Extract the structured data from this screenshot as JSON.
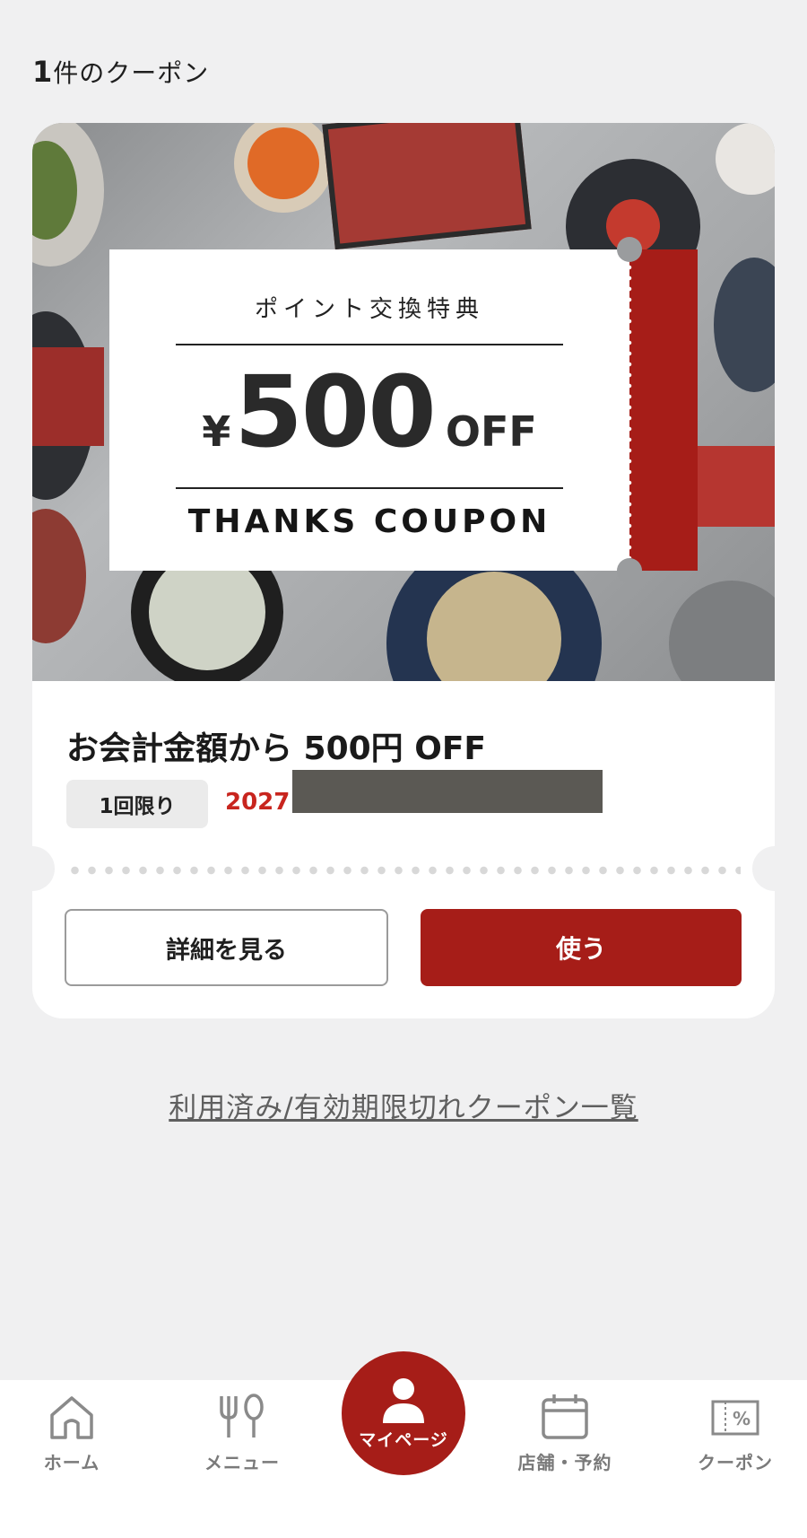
{
  "header": {
    "count_number": "1",
    "count_suffix": "件のクーポン"
  },
  "coupon": {
    "banner": {
      "subtitle": "ポイント交換特典",
      "currency": "¥",
      "amount": "500",
      "off": "OFF",
      "caption": "THANKS COUPON"
    },
    "title": "お会計金額から 500円 OFF",
    "limit_badge": "1回限り",
    "expiry_visible": "2027",
    "detail_button": "詳細を見る",
    "use_button": "使う"
  },
  "history_link": "利用済み/有効期限切れクーポン一覧",
  "bottom_nav": {
    "items": [
      {
        "label": "ホーム",
        "icon": "home-icon"
      },
      {
        "label": "メニュー",
        "icon": "fork-spoon-icon"
      },
      {
        "label": "マイページ",
        "icon": "person-icon",
        "active": true
      },
      {
        "label": "店舗・予約",
        "icon": "calendar-icon"
      },
      {
        "label": "クーポン",
        "icon": "coupon-percent-icon"
      }
    ]
  },
  "colors": {
    "brand_red": "#a61d18",
    "expiry_red": "#c8251e",
    "background": "#f0f0f1"
  }
}
